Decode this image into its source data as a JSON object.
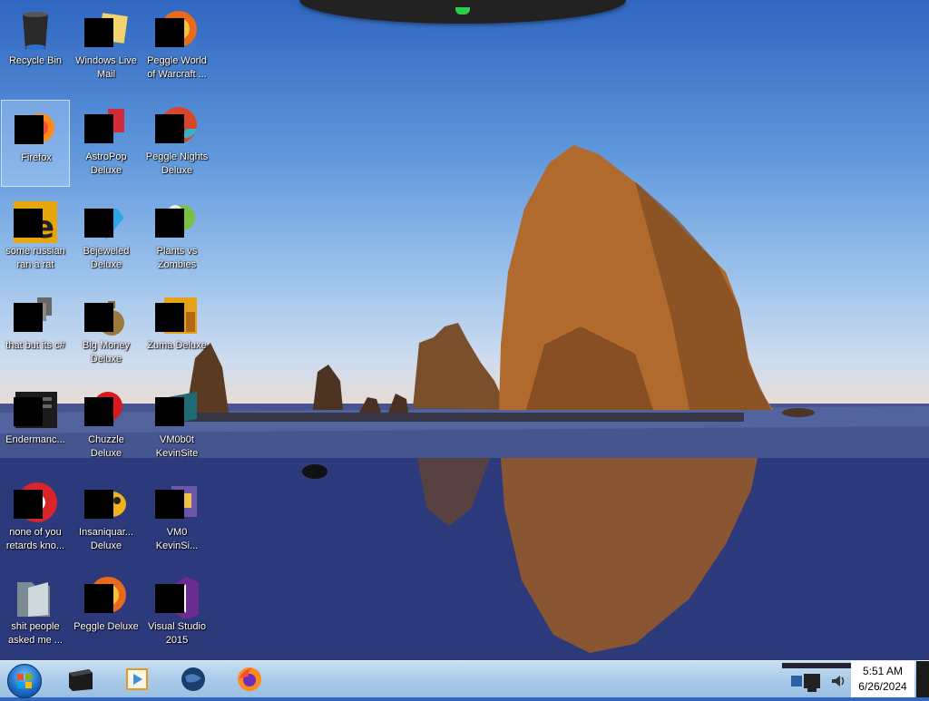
{
  "desktop": {
    "icons": [
      {
        "label": "Recycle Bin",
        "icon": "recycle-bin-icon"
      },
      {
        "label": "Windows Live\nMail",
        "icon": "mail-icon"
      },
      {
        "label": "Peggle World\nof Warcraft ...",
        "icon": "peggle-icon"
      },
      {
        "label": "Firefox",
        "icon": "firefox-icon"
      },
      {
        "label": "AstroPop\nDeluxe",
        "icon": "astropop-icon"
      },
      {
        "label": "Peggle Nights\nDeluxe",
        "icon": "peggle-nights-icon"
      },
      {
        "label": "some russian\nran a rat",
        "icon": "file-icon"
      },
      {
        "label": "Bejeweled\nDeluxe",
        "icon": "bejeweled-icon"
      },
      {
        "label": "Plants vs\nZombies",
        "icon": "plants-vs-zombies-icon"
      },
      {
        "label": "that but its c#",
        "icon": "shortcut-icon"
      },
      {
        "label": "Big Money\nDeluxe",
        "icon": "money-bag-icon"
      },
      {
        "label": "Zuma Deluxe",
        "icon": "zuma-icon"
      },
      {
        "label": "Endermanc...",
        "icon": "app-icon"
      },
      {
        "label": "Chuzzle\nDeluxe",
        "icon": "chuzzle-icon"
      },
      {
        "label": "VM0b0t\nKevinSite",
        "icon": "vm-icon"
      },
      {
        "label": "none of you\nretards kno...",
        "icon": "chrome-icon"
      },
      {
        "label": "Insaniquar...\nDeluxe",
        "icon": "fish-icon"
      },
      {
        "label": "VM0\nKevinSi...",
        "icon": "vm-icon"
      },
      {
        "label": "shit people\nasked me ...",
        "icon": "folder-icon"
      },
      {
        "label": "Peggle Deluxe",
        "icon": "peggle-icon"
      },
      {
        "label": "Visual Studio\n2015",
        "icon": "visual-studio-icon"
      }
    ]
  },
  "taskbar": {
    "start": "start-orb-icon",
    "pinned": [
      "terminal-icon",
      "media-player-icon",
      "globe-icon",
      "firefox-icon"
    ],
    "clock": {
      "time": "5:51 AM",
      "date": "6/26/2024"
    }
  }
}
